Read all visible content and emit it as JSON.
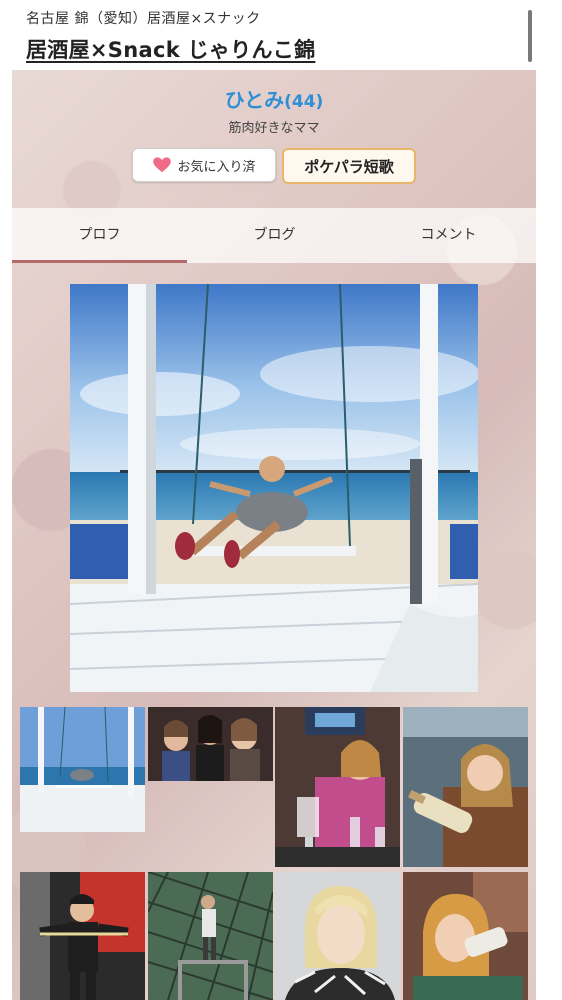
{
  "header": {
    "area": "名古屋 錦（愛知）居酒屋×スナック",
    "shop_name": "居酒屋×Snack じゃりんこ錦"
  },
  "profile": {
    "name": "ひとみ",
    "age": "(44)",
    "catch_copy": "筋肉好きなママ",
    "favorite_label": "お気に入り済",
    "tanka_label": "ポケパラ短歌"
  },
  "tabs": [
    {
      "label": "プロフ",
      "active": true
    },
    {
      "label": "ブログ",
      "active": false
    },
    {
      "label": "コメント",
      "active": false
    }
  ],
  "photos": {
    "main": "beach-swing-photo",
    "thumbnails": [
      "beach-swing-thumb",
      "group-photo-thumb",
      "toast-drink-thumb",
      "bottle-smile-thumb",
      "gym-pose-thumb",
      "batting-cage-thumb",
      "selfie-thumb",
      "bottle-kiss-thumb"
    ]
  },
  "colors": {
    "name_blue": "#2e8fd6",
    "tab_underline": "#b36a6a",
    "heart_pink": "#f06a8a",
    "tanka_border": "#e8b66a"
  }
}
